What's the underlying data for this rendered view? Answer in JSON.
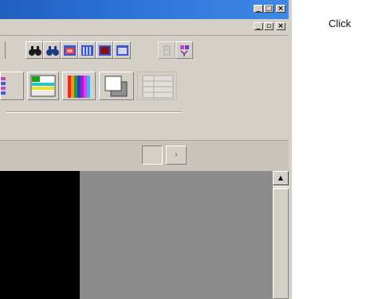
{
  "window": {
    "caption_buttons": {
      "minimize": "_",
      "maximize": "□",
      "close": "×"
    },
    "mdi_buttons": {
      "minimize": "_",
      "restore": "▫",
      "close": "×"
    }
  },
  "toolbar_row1": {
    "buttons": [
      {
        "icon": "binoculars-find-icon"
      },
      {
        "icon": "binoculars-find-next-icon"
      },
      {
        "icon": "red-frame-icon"
      },
      {
        "icon": "columns-grid-icon"
      },
      {
        "icon": "dark-red-frame-icon"
      },
      {
        "icon": "window-frame-icon"
      },
      {
        "icon": "disabled-tool-icon"
      },
      {
        "icon": "properties-icon"
      }
    ]
  },
  "toolbar_row2": {
    "buttons": [
      {
        "icon": "palette-grid-icon"
      },
      {
        "icon": "color-table-icon"
      },
      {
        "icon": "color-bars-icon"
      },
      {
        "icon": "overlapping-windows-icon"
      },
      {
        "icon": "gray-table-icon"
      }
    ]
  },
  "status": {
    "nav_glyph": "›"
  },
  "scrollbar": {
    "up_arrow": "▲"
  },
  "colors": {
    "title_bar": "#2b72d6",
    "viewport_left": "#000000",
    "viewport_right": "#8c8c8c"
  },
  "side_text": "Click"
}
